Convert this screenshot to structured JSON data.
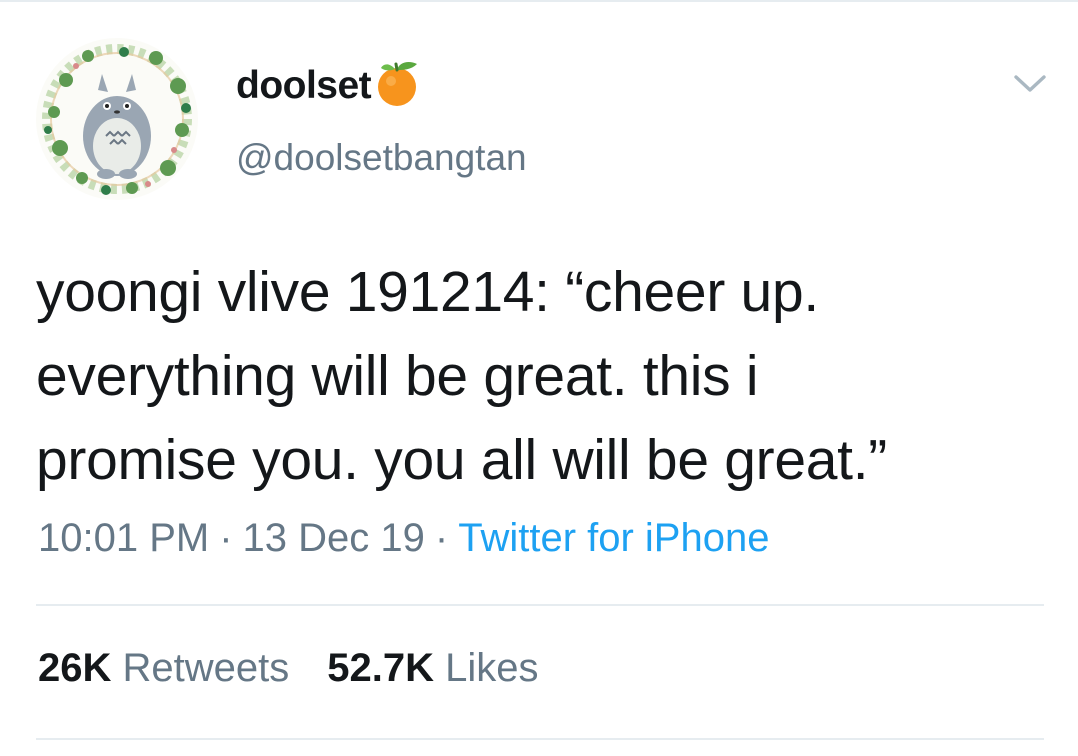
{
  "user": {
    "display_name": "doolset",
    "handle": "@doolsetbangtan",
    "name_emoji_icon": "tangerine-icon",
    "avatar_icon": "totoro-wreath-avatar"
  },
  "tweet": {
    "text": "yoongi vlive 191214: “cheer up.\neverything will be great. this i\npromise you. you all will be great.”",
    "time": "10:01 PM",
    "separator": "·",
    "date": "13 Dec 19",
    "source": "Twitter for iPhone"
  },
  "stats": {
    "retweets_count": "26K",
    "retweets_label": "Retweets",
    "likes_count": "52.7K",
    "likes_label": "Likes"
  },
  "colors": {
    "text_primary": "#14171a",
    "text_secondary": "#657786",
    "link_blue": "#1da1f2",
    "divider": "#e6ecf0",
    "tangerine": "#f7941d"
  },
  "icons": {
    "caret": "chevron-down-icon"
  }
}
